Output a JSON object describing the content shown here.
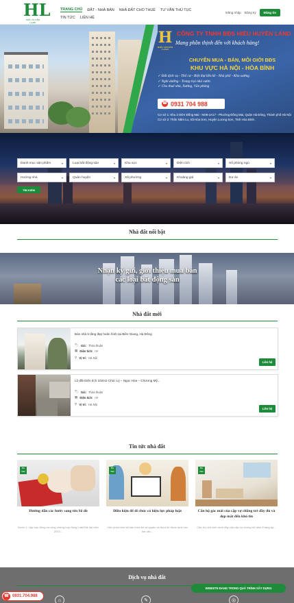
{
  "header": {
    "logo_text": "HL",
    "logo_sub": "HIỂU HUYỀN LAND",
    "nav_row1": [
      "TRANG CHỦ",
      "ĐẤT - NHÀ BÁN",
      "NHÀ ĐẤT CHO THUÊ",
      "TƯ VẤN THỦ TỤC"
    ],
    "nav_row2": [
      "TIN TỨC",
      "LIÊN HỆ"
    ],
    "login": "Đăng nhập",
    "register": "Đăng ký",
    "post_button": "Đăng tin"
  },
  "banner": {
    "logo": "H",
    "logo_sub": "HIỂU HUYỀN LAND",
    "company": "CÔNG TY TNHH BĐS HIỂU HUYỀN LAND",
    "slogan": "Mang phồn thịnh đến với khách hàng!",
    "headline1": "CHUYÊN MUA - BÁN, MÔI GIỚI BĐS",
    "headline2": "KHU VỰC HÀ NỘI - HÒA BÌNH",
    "bullets": [
      "✓ Đất dịch vụ - Thổ cư - Biệt thự liền kề - Nhà phố - Kho xưởng",
      "✓ Nghỉ dưỡng - Trang trại nhà vườn",
      "✓ Cho thuê nhà, Xưởng, Văn phòng"
    ],
    "phone": "0931 704 988",
    "address1": "Cơ sở 1: Khu 2 DDV Đồng Mai - NO8-LK17 - Phường Đồng Mai, Quận Hà Đông, Thành phố Hà Nội",
    "address2": "Cơ sở 2: Thôn Năm Lu, Xã Hòa Sơn, Huyện Lương Sơn, Tỉnh Hòa Bình ."
  },
  "search": {
    "row1": [
      "Danh mục sản phẩm",
      "Loại bất động sản",
      "Khu vực",
      "Diện tích",
      "Số phòng ngủ"
    ],
    "row2": [
      "Hướng nhà",
      "Quận huyện",
      "Xã phường",
      "Khoảng giá",
      "Dự án"
    ],
    "button": "TÌM KIẾM"
  },
  "featured": {
    "title": "Nhà đất nổi bật"
  },
  "consign": {
    "line1": "Nhận ký gửi, giới thiệu mua bán",
    "line2": "các loại bất động sản"
  },
  "new_listings": {
    "title": "Nhà đất mới",
    "items": [
      {
        "title": "Bán nhà 5 tầng đẹp hoàn hình tại Biên Giang, Hà Đông",
        "price_label": "Giá:",
        "price": "Thỏa thuận",
        "area_label": "Diện tích:",
        "area": "m²",
        "loc_label": "Vị trí:",
        "loc": "Hà Nội",
        "more": "Liên hệ"
      },
      {
        "title": "Lô đất Diện tích 102m2 Chúc Lý – Ngọc Hòa – Chương Mỹ...",
        "price_label": "Giá:",
        "price": "Thỏa thuận",
        "area_label": "Diện tích:",
        "area": "m²",
        "loc_label": "Vị trí:",
        "loc": "Hà Nội",
        "more": "Liên hệ"
      }
    ]
  },
  "news": {
    "title": "Tin tức nhà đất",
    "tag": "Tin Tức",
    "items": [
      {
        "title": "Hướng dẫn các bước sang tên Sổ đỏ",
        "excerpt": "Bước 1: Lập hợp đồng và công chứng hợp đồng Luật Đất đai năm 2013..."
      },
      {
        "title": "Điều kiện để di chúc có hiệu lực pháp luật",
        "excerpt": "Việc phân chia tài sản thừa kế và quyền và thừa kế được dựa vào hai căn..."
      },
      {
        "title": "Căn hộ gác mái của cặp vợ chồng trẻ đầy đủ và đẹp mắt đến khó tin",
        "excerpt": "Căn hộ nhỏ xinh dưới đây của cặp vợ chồng trẻ nằm ở tầng áp..."
      }
    ]
  },
  "services": {
    "title": "Dịch vụ nhà đất"
  },
  "hotline": "0931.704.988",
  "building_badge": "WEBSITE ĐANG TRONG QUÁ TRÌNH XÂY DỰNG",
  "colors": {
    "brand_green": "#1e8b3a",
    "hotline_red": "#e23b2e"
  }
}
